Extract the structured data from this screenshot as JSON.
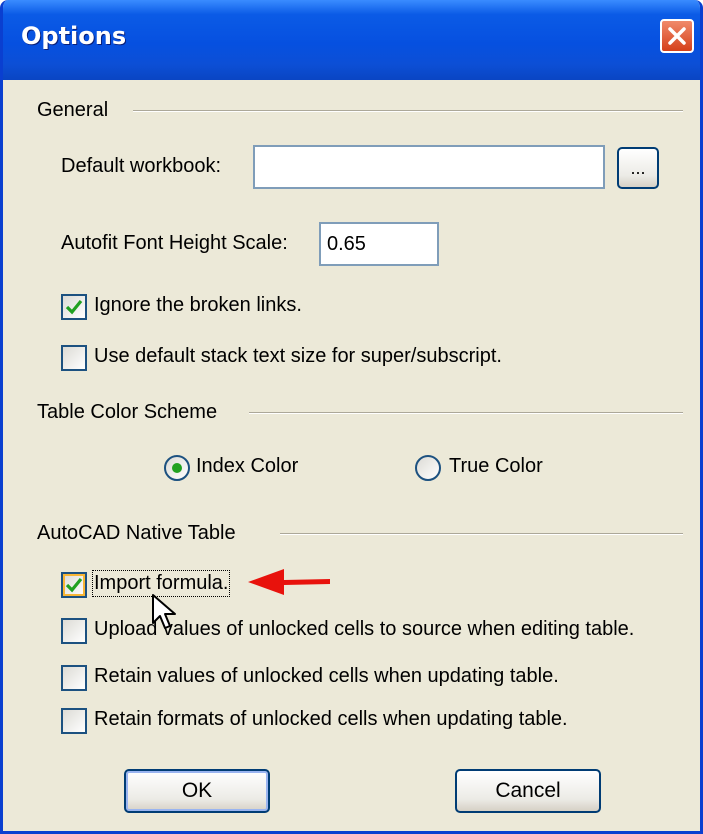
{
  "window": {
    "title": "Options"
  },
  "general": {
    "heading": "General",
    "default_workbook_label": "Default workbook:",
    "default_workbook_value": "",
    "browse_label": "...",
    "autofit_label": "Autofit Font Height Scale:",
    "autofit_value": "0.65",
    "ignore_broken_links": {
      "label": "Ignore the broken links.",
      "checked": true
    },
    "default_stack_text": {
      "label": "Use default stack text size for super/subscript.",
      "checked": false
    }
  },
  "color_scheme": {
    "heading": "Table Color Scheme",
    "options": [
      {
        "label": "Index Color",
        "selected": true
      },
      {
        "label": "True Color",
        "selected": false
      }
    ]
  },
  "native_table": {
    "heading": "AutoCAD Native Table",
    "items": [
      {
        "label": "Import formula.",
        "checked": true
      },
      {
        "label": "Upload values of unlocked cells to source when editing table.",
        "checked": false
      },
      {
        "label": "Retain values of unlocked cells when updating table.",
        "checked": false
      },
      {
        "label": "Retain formats of unlocked cells when updating table.",
        "checked": false
      }
    ]
  },
  "buttons": {
    "ok_label": "OK",
    "cancel_label": "Cancel"
  },
  "colors": {
    "title_bar": "#0650e0",
    "dialog_bg": "#ece9d8",
    "check_mark": "#21a121",
    "annotation_arrow": "#e8120c"
  },
  "icons": {
    "close": "close-icon",
    "check": "check-icon",
    "cursor": "mouse-cursor-icon",
    "arrow": "red-arrow-icon"
  }
}
